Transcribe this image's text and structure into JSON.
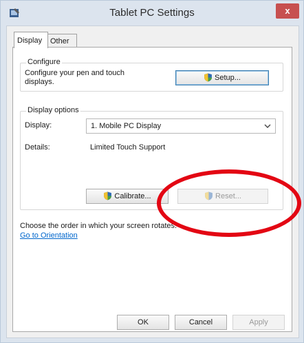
{
  "window": {
    "title": "Tablet PC Settings",
    "close_label": "x"
  },
  "tabs": [
    {
      "label": "Display"
    },
    {
      "label": "Other"
    }
  ],
  "configure": {
    "legend": "Configure",
    "description": "Configure your pen and touch displays.",
    "setup_label": "Setup..."
  },
  "display_options": {
    "legend": "Display options",
    "display_label": "Display:",
    "display_value": "1. Mobile PC Display",
    "details_label": "Details:",
    "details_value": "Limited Touch Support",
    "calibrate_label": "Calibrate...",
    "reset_label": "Reset..."
  },
  "orientation": {
    "text": "Choose the order in which your screen rotates.",
    "link": "Go to Orientation"
  },
  "footer": {
    "ok_label": "OK",
    "cancel_label": "Cancel",
    "apply_label": "Apply"
  },
  "colors": {
    "annotation": "#e30613",
    "link": "#0066cc",
    "titlebar": "#dce4ee",
    "close": "#c75050"
  }
}
